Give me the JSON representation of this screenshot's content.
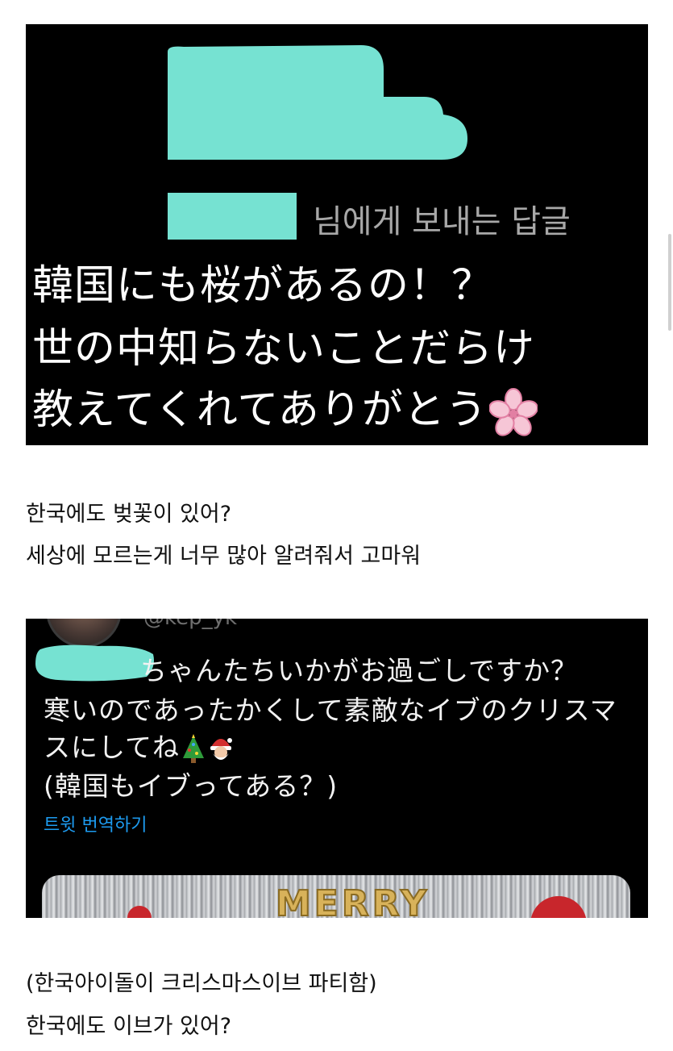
{
  "screenshot1": {
    "reply_label": "님에게 보내는 답글",
    "jp_lines": [
      "韓国にも桜があるの！？",
      "世の中知らないことだらけ",
      "教えてくれてありがとう"
    ],
    "end_icon": "cherry-blossom-icon",
    "redaction_color": "#76e2d2"
  },
  "caption1": {
    "line1": "한국에도 벚꽃이 있어?",
    "line2": "세상에 모르는게 너무 많아 알려줘서 고마워"
  },
  "screenshot2": {
    "handle": "@kep_yk",
    "tweet_lines": [
      "ちゃんたちいかがお過ごしですか？",
      "寒いのであったかくして素敵なイブのクリスマ",
      "スにしてね",
      "(韓国もイブってある？)"
    ],
    "emoji_icons": [
      "christmas-tree-icon",
      "santa-icon"
    ],
    "translate_link": "트윗 번역하기",
    "photo_text": "MERRY",
    "link_color": "#1d9bf0"
  },
  "caption2": {
    "line1": "(한국아이돌이 크리스마스이브 파티함)",
    "line2": "한국에도 이브가 있어?"
  }
}
